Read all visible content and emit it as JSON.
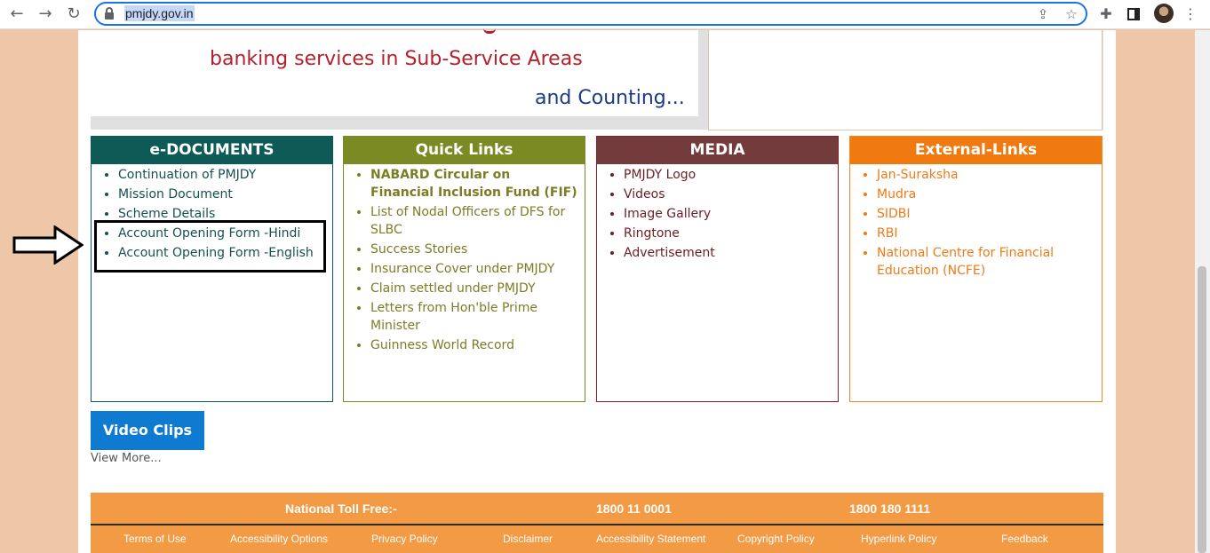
{
  "browser": {
    "url": "pmjdy.gov.in",
    "back_icon": "←",
    "forward_icon": "→",
    "reload_icon": "↻",
    "share_icon": "⇪",
    "star_icon": "☆",
    "extensions_icon": "✚",
    "menu_icon": "⋮"
  },
  "banner": {
    "line1": "banking services in Sub-Service Areas",
    "line2": "and Counting..."
  },
  "edocuments": {
    "title": "e-DOCUMENTS",
    "items": [
      "Continuation of PMJDY",
      "Mission Document",
      "Scheme Details",
      "Account Opening Form -Hindi",
      "Account Opening Form -English"
    ]
  },
  "quick_links": {
    "title": "Quick Links",
    "items": [
      "NABARD Circular on Financial Inclusion Fund (FIF)",
      "List of Nodal Officers of DFS for SLBC",
      "Success Stories",
      "Insurance Cover under PMJDY",
      "Claim settled under PMJDY",
      "Letters from Hon'ble Prime Minister",
      "Guinness World Record"
    ]
  },
  "media": {
    "title": "MEDIA",
    "items": [
      "PMJDY Logo",
      "Videos",
      "Image Gallery",
      "Ringtone",
      "Advertisement"
    ]
  },
  "external": {
    "title": "External-Links",
    "items": [
      "Jan-Suraksha",
      "Mudra",
      "SIDBI",
      "RBI",
      "National Centre for Financial Education (NCFE)"
    ]
  },
  "video": {
    "button": "Video Clips",
    "view_more": "View More..."
  },
  "footer": {
    "toll_label": "National Toll Free:-",
    "toll1": "1800 11 0001",
    "toll2": "1800 180 1111",
    "links": [
      "Terms of Use",
      "Accessibility Options",
      "Privacy Policy",
      "Disclaimer",
      "Accessibility Statement",
      "Copyright Policy",
      "Hyperlink Policy",
      "Feedback"
    ]
  },
  "colors": {
    "edoc": "#0e5a57",
    "quick_links": "#7b8a22",
    "media": "#733b3b",
    "external": "#f07a10",
    "footer": "#f39a45"
  }
}
